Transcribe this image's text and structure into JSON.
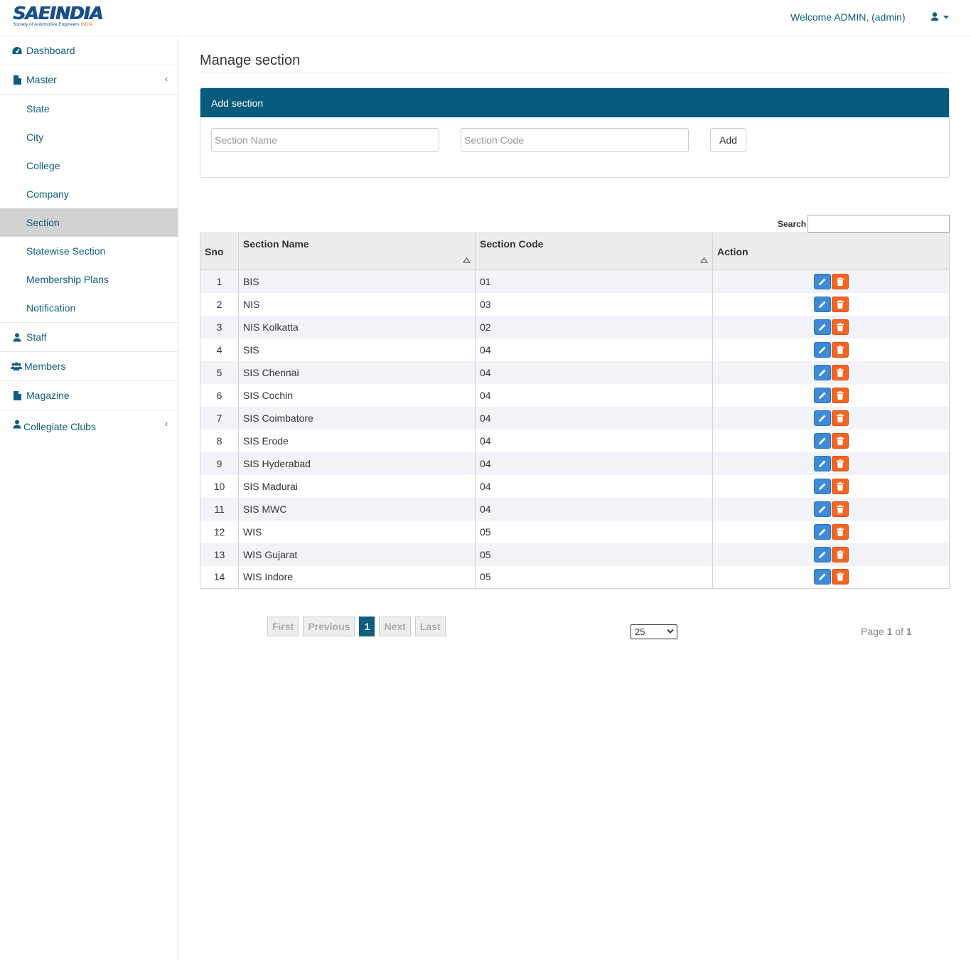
{
  "header": {
    "logo_text": "SAEINDIA",
    "logo_tagline_a": "Society of Automotive Engineers ",
    "logo_tagline_b": "INDIA",
    "welcome": "Welcome ADMIN, (admin)"
  },
  "sidebar": {
    "dashboard": "Dashboard",
    "master": "Master",
    "master_items": [
      "State",
      "City",
      "College",
      "Company",
      "Section",
      "Statewise Section",
      "Membership Plans",
      "Notification"
    ],
    "active_item": "Section",
    "staff": "Staff",
    "members": "Members",
    "magazine": "Magazine",
    "collegiate_clubs": "Collegiate Clubs"
  },
  "page": {
    "title": "Manage section"
  },
  "add_panel": {
    "heading": "Add section",
    "name_placeholder": "Section Name",
    "code_placeholder": "Section Code",
    "add_label": "Add"
  },
  "table": {
    "search_label": "Search",
    "columns": [
      "Sno",
      "Section Name",
      "Section Code",
      "Action"
    ],
    "rows": [
      {
        "sno": "1",
        "name": "BIS",
        "code": "01"
      },
      {
        "sno": "2",
        "name": "NIS",
        "code": "03"
      },
      {
        "sno": "3",
        "name": "NIS Kolkatta",
        "code": "02"
      },
      {
        "sno": "4",
        "name": "SIS",
        "code": "04"
      },
      {
        "sno": "5",
        "name": "SIS Chennai",
        "code": "04"
      },
      {
        "sno": "6",
        "name": "SIS Cochin",
        "code": "04"
      },
      {
        "sno": "7",
        "name": "SIS Coimbatore",
        "code": "04"
      },
      {
        "sno": "8",
        "name": "SIS Erode",
        "code": "04"
      },
      {
        "sno": "9",
        "name": "SIS Hyderabad",
        "code": "04"
      },
      {
        "sno": "10",
        "name": "SIS Madurai",
        "code": "04"
      },
      {
        "sno": "11",
        "name": "SIS MWC",
        "code": "04"
      },
      {
        "sno": "12",
        "name": "WIS",
        "code": "05"
      },
      {
        "sno": "13",
        "name": "WIS Gujarat",
        "code": "05"
      },
      {
        "sno": "14",
        "name": "WIS Indore",
        "code": "05"
      }
    ]
  },
  "pagination": {
    "first": "First",
    "previous": "Previous",
    "current": "1",
    "next": "Next",
    "last": "Last",
    "page_size": "25",
    "page_word": "Page",
    "page_current": "1",
    "of_word": "of",
    "page_total": "1"
  },
  "icons": {
    "edit": "pencil-icon",
    "delete": "trash-icon",
    "user": "user-icon"
  },
  "colors": {
    "brand": "#045b7b",
    "link": "#0d5f7d",
    "edit_button": "#3c8bd8",
    "delete_button": "#f26522",
    "active_nav": "#d2d2d2"
  }
}
